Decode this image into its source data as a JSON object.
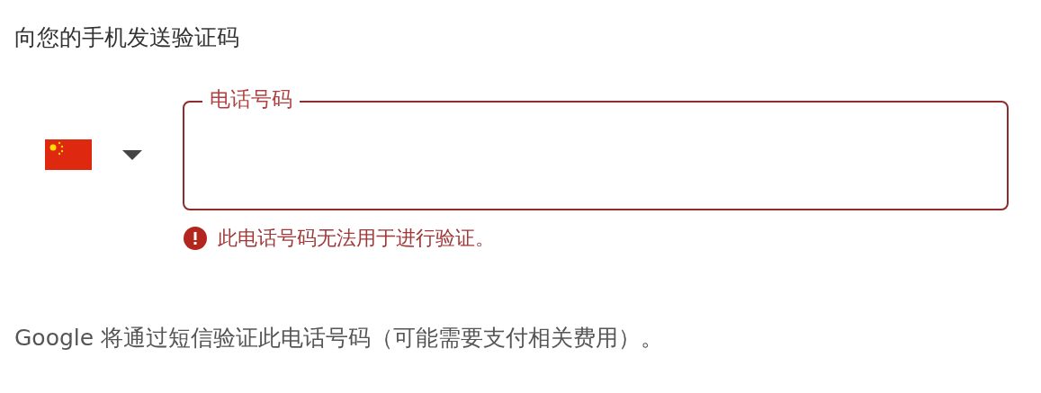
{
  "heading": "向您的手机发送验证码",
  "phone_field": {
    "label": "电话号码",
    "error": true,
    "error_message": "此电话号码无法用于进行验证。"
  },
  "footer_note": "Google 将通过短信验证此电话号码（可能需要支付相关费用）。"
}
